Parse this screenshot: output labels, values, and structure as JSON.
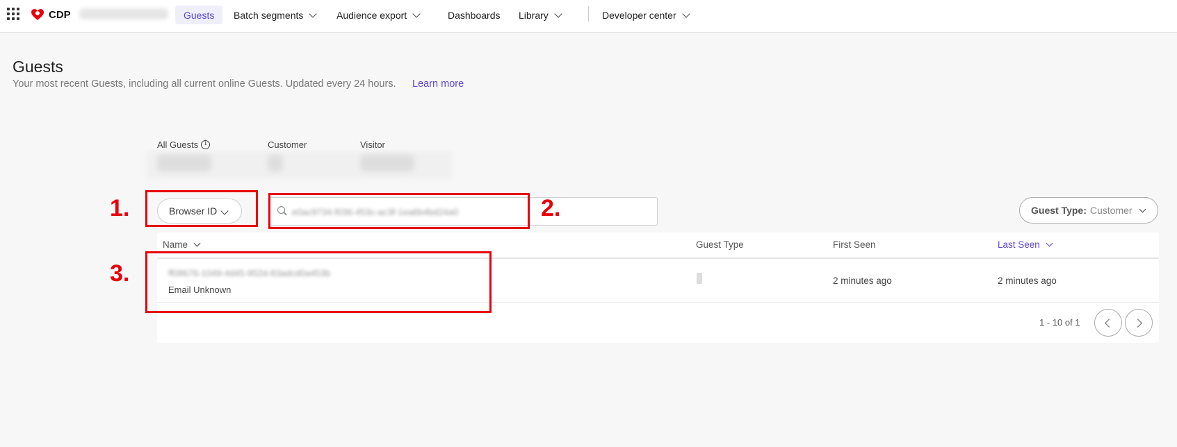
{
  "nav": {
    "brand": "CDP",
    "items": [
      {
        "label": "Guests"
      },
      {
        "label": "Batch segments"
      },
      {
        "label": "Audience export"
      },
      {
        "label": "Dashboards"
      },
      {
        "label": "Library"
      },
      {
        "label": "Developer center"
      }
    ]
  },
  "header": {
    "title": "Guests",
    "subtitle": "Your most recent Guests, including all current online Guests. Updated every 24 hours.",
    "learn_more": "Learn more"
  },
  "counts": [
    {
      "label": "All Guests"
    },
    {
      "label": "Customer"
    },
    {
      "label": "Visitor"
    }
  ],
  "filters": {
    "identifier": "Browser ID",
    "search_value": "e0ac9734-f036-453c-ac3f-1ea6b4bd24a0",
    "guest_type_label": "Guest Type:",
    "guest_type_value": "Customer"
  },
  "table": {
    "columns": [
      "Name",
      "Guest Type",
      "First Seen",
      "Last Seen"
    ],
    "rows": [
      {
        "id": "ff08676-1049-4d45-952d-83adcd0a453b",
        "email": "Email Unknown",
        "first_seen": "2 minutes ago",
        "last_seen": "2 minutes ago"
      }
    ],
    "pagination": "1 - 10 of 1"
  },
  "annotations": [
    "1.",
    "2.",
    "3."
  ],
  "colors": {
    "accent": "#5b46d6",
    "annotation": "#e8000b"
  }
}
